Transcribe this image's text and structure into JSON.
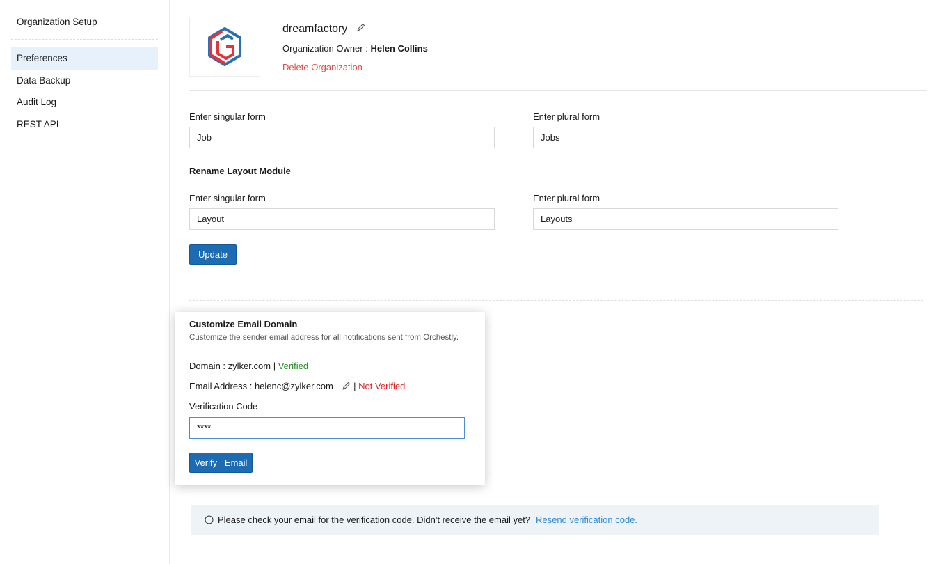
{
  "sidebar": {
    "header": "Organization Setup",
    "items": [
      {
        "label": "Preferences",
        "active": true
      },
      {
        "label": "Data Backup"
      },
      {
        "label": "Audit Log"
      },
      {
        "label": "REST API"
      }
    ]
  },
  "org": {
    "name": "dreamfactory",
    "owner_label": "Organization Owner :",
    "owner_name": "Helen Collins",
    "delete_label": "Delete Organization"
  },
  "job_module": {
    "singular_label": "Enter singular form",
    "singular_value": "Job",
    "plural_label": "Enter plural form",
    "plural_value": "Jobs"
  },
  "layout_module": {
    "title": "Rename Layout Module",
    "singular_label": "Enter singular form",
    "singular_value": "Layout",
    "plural_label": "Enter plural form",
    "plural_value": "Layouts"
  },
  "update_label": "Update",
  "email_domain": {
    "title": "Customize Email Domain",
    "description": "Customize the sender email address for all notifications sent from Orchestly.",
    "domain_label": "Domain :",
    "domain_value": "zylker.com",
    "separator": "|",
    "domain_status": "Verified",
    "email_label": "Email Address :",
    "email_value": "helenc@zylker.com",
    "email_status": "Not Verified",
    "code_label": "Verification Code",
    "code_value": "****",
    "verify_label": "Verify   Email"
  },
  "banner": {
    "message": "Please check your email for the verification code. Didn't receive the email yet?",
    "link": "Resend verification code."
  },
  "colors": {
    "primary": "#1d6bb3",
    "danger": "#e24b4b",
    "success": "#1e8e1e",
    "link": "#2b8ad6",
    "active_bg": "#e7f1fb"
  }
}
